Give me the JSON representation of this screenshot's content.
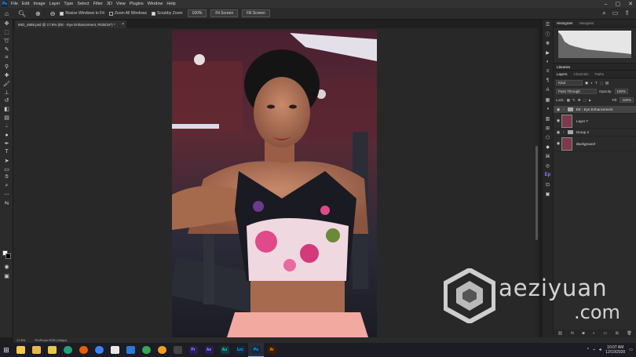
{
  "menubar": {
    "logo": "Ps",
    "items": [
      "File",
      "Edit",
      "Image",
      "Layer",
      "Type",
      "Select",
      "Filter",
      "3D",
      "View",
      "Plugins",
      "Window",
      "Help"
    ]
  },
  "options": {
    "resize_windows": "Resize Windows to Fit",
    "zoom_all": "Zoom All Windows",
    "scrubby_zoom": "Scrubby Zoom",
    "zoom_pct": "100%",
    "fit_screen": "Fit Screen",
    "fill_screen": "Fill Screen"
  },
  "document": {
    "tab_title": "IMG_4655.psd @ 17.8% (EE - Eye Enhancement, RGB/16*) *",
    "close": "×"
  },
  "panels": {
    "top_tabs": [
      "Histogram",
      "Navigator"
    ],
    "libraries_title": "Libraries",
    "layer_tabs": [
      "Layers",
      "Channels",
      "Paths"
    ],
    "kind_label": "Kind",
    "blend_mode": "Pass Through",
    "opacity_label": "Opacity:",
    "opacity_value": "100%",
    "lock_label": "Lock:",
    "fill_label": "Fill:",
    "fill_value": "100%",
    "layers": [
      {
        "name": "EE - Eye Enhancement",
        "type": "group",
        "selected": true
      },
      {
        "name": "Layer 7",
        "type": "layer"
      },
      {
        "name": "Group 3",
        "type": "group"
      },
      {
        "name": "Background",
        "type": "layer",
        "italic": true
      }
    ]
  },
  "status": {
    "zoom": "17.8%",
    "profile": "ProPhoto RGB (16bpc)"
  },
  "taskbar": {
    "apps": [
      {
        "label": "",
        "color": "#f7c948"
      },
      {
        "label": "",
        "color": "#e8b84a"
      },
      {
        "label": "",
        "color": "#e8c84a"
      },
      {
        "label": "",
        "color": "#1fa37a"
      },
      {
        "label": "",
        "color": "#e66000"
      },
      {
        "label": "",
        "color": "#3b82f6"
      },
      {
        "label": "",
        "color": "#e8e8e8"
      },
      {
        "label": "",
        "color": "#2a7bd4"
      },
      {
        "label": "",
        "color": "#34a853"
      },
      {
        "label": "",
        "color": "#f29e1f"
      },
      {
        "label": "",
        "color": "#444444"
      },
      {
        "label": "Pr",
        "color": "#2b1b5a"
      },
      {
        "label": "Ae",
        "color": "#2b1b5a"
      },
      {
        "label": "Au",
        "color": "#123c42"
      },
      {
        "label": "Lrc",
        "color": "#0f2a44"
      },
      {
        "label": "Ps",
        "color": "#0f2a44"
      },
      {
        "label": "Ai",
        "color": "#3c1b00"
      }
    ],
    "time": "10:07 AM",
    "date": "12/19/2020"
  },
  "watermark": {
    "line1": "aeziyuan",
    "line2": ".com"
  },
  "colors": {
    "ps_blue": "#31a8ff",
    "panel_bg": "#2b2b2b"
  }
}
